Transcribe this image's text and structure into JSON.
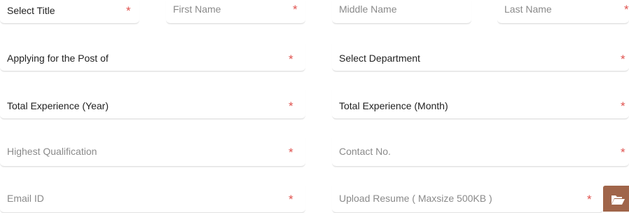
{
  "form": {
    "row1": {
      "title_select": "Select Title",
      "first_name": "First Name",
      "middle_name": "Middle Name",
      "last_name": "Last Name"
    },
    "row2": {
      "post_select": "Applying for the Post of",
      "department_select": "Select Department"
    },
    "row3": {
      "experience_year": "Total Experience (Year)",
      "experience_month": "Total Experience (Month)"
    },
    "row4": {
      "qualification": "Highest Qualification",
      "contact": "Contact No."
    },
    "row5": {
      "email": "Email ID",
      "resume": "Upload Resume ( Maxsize 500KB )"
    },
    "required_marker": "*",
    "upload_icon": "folder-open-icon"
  },
  "colors": {
    "required": "#e0534f",
    "upload_button": "#a0654a",
    "label_dark": "#222222",
    "label_light": "#8a8a8a",
    "border": "#e2e2e2"
  }
}
